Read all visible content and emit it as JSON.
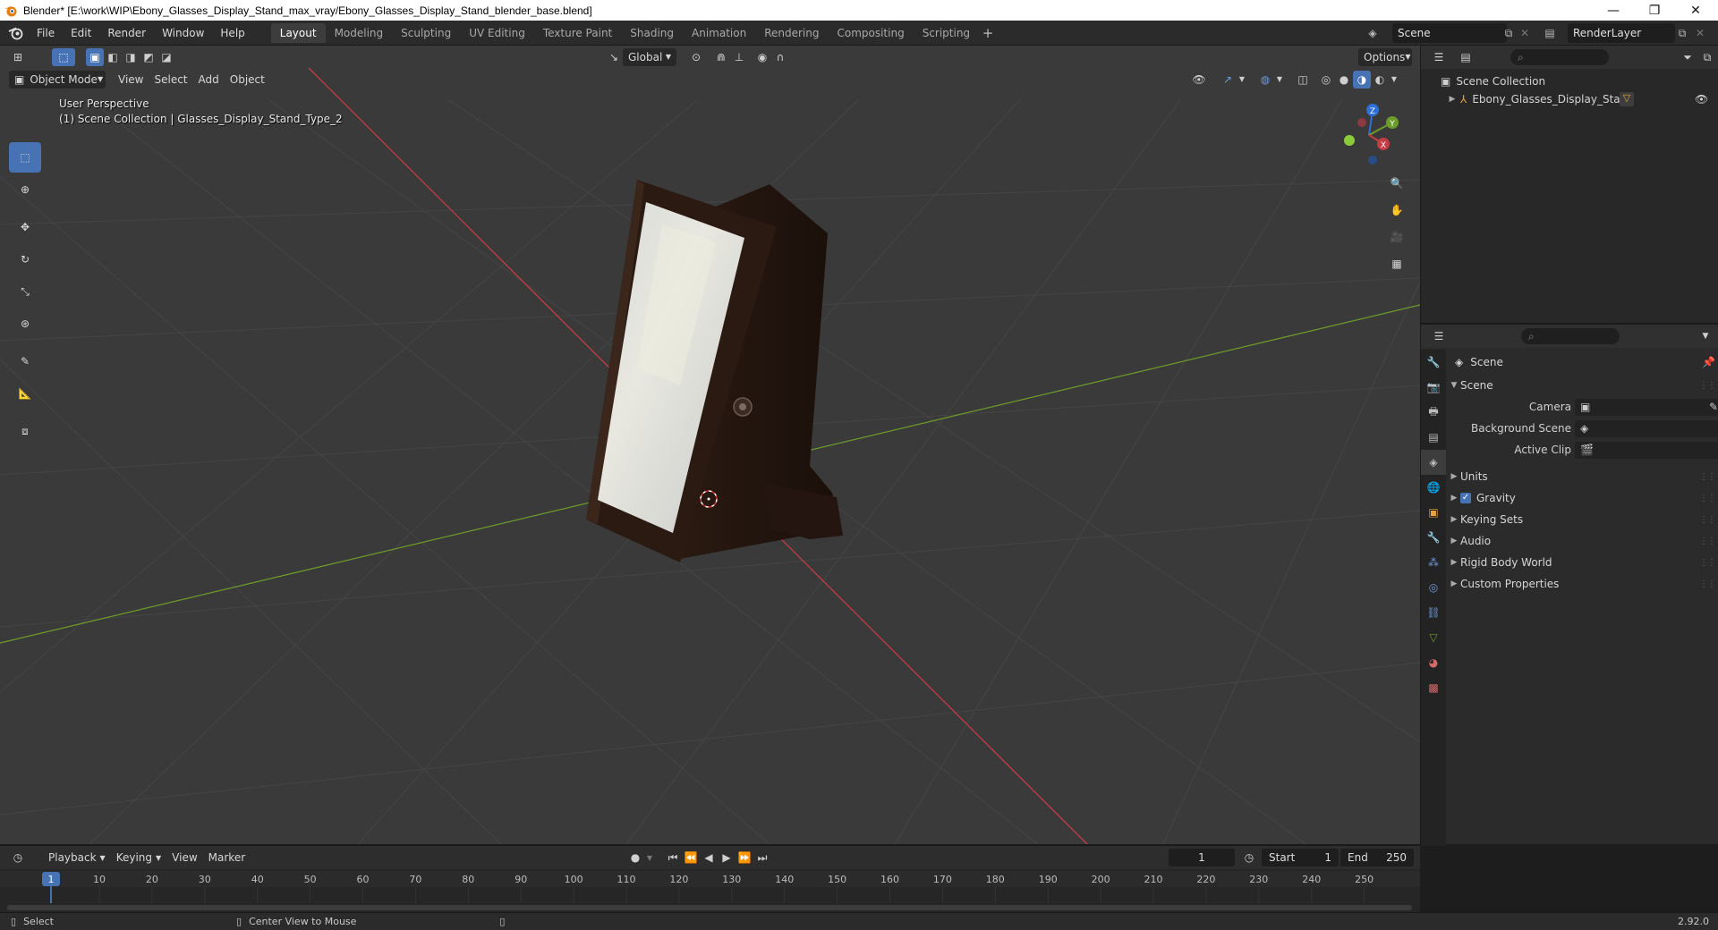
{
  "window": {
    "title": "Blender* [E:\\work\\WIP\\Ebony_Glasses_Display_Stand_max_vray/Ebony_Glasses_Display_Stand_blender_base.blend]",
    "minimize": "—",
    "maximize": "❐",
    "close": "✕"
  },
  "menu": [
    "File",
    "Edit",
    "Render",
    "Window",
    "Help"
  ],
  "workspaces": [
    "Layout",
    "Modeling",
    "Sculpting",
    "UV Editing",
    "Texture Paint",
    "Shading",
    "Animation",
    "Rendering",
    "Compositing",
    "Scripting"
  ],
  "active_workspace": "Layout",
  "scene_name": "Scene",
  "view_layer": "RenderLayer",
  "viewport": {
    "mode": "Object Mode",
    "menus": [
      "View",
      "Select",
      "Add",
      "Object"
    ],
    "transform_orientation": "Global",
    "options_label": "Options",
    "perspective_label": "User Perspective",
    "collection_label": "(1) Scene Collection | Glasses_Display_Stand_Type_2",
    "gizmo_axes": {
      "x": "X",
      "y": "Y",
      "z": "Z"
    }
  },
  "outliner": {
    "root": "Scene Collection",
    "items": [
      "Ebony_Glasses_Display_Stand"
    ]
  },
  "properties": {
    "context_title": "Scene",
    "panel_scene": "Scene",
    "camera_label": "Camera",
    "background_scene_label": "Background Scene",
    "active_clip_label": "Active Clip",
    "panels": [
      "Units",
      "Gravity",
      "Keying Sets",
      "Audio",
      "Rigid Body World",
      "Custom Properties"
    ],
    "gravity_checked": "✓"
  },
  "timeline": {
    "menus": [
      "Playback",
      "Keying",
      "View",
      "Marker"
    ],
    "current_frame": "1",
    "start_label": "Start",
    "start_value": "1",
    "end_label": "End",
    "end_value": "250",
    "ticks": [
      "1",
      "10",
      "20",
      "30",
      "40",
      "50",
      "60",
      "70",
      "80",
      "90",
      "100",
      "110",
      "120",
      "130",
      "140",
      "150",
      "160",
      "170",
      "180",
      "190",
      "200",
      "210",
      "220",
      "230",
      "240",
      "250"
    ]
  },
  "statusbar": {
    "select": "Select",
    "center_view": "Center View to Mouse",
    "version": "2.92.0"
  },
  "colors": {
    "accent": "#4772b3",
    "x_axis": "#c43c44",
    "y_axis": "#6c9c2a",
    "z_axis": "#2f6fd6"
  }
}
